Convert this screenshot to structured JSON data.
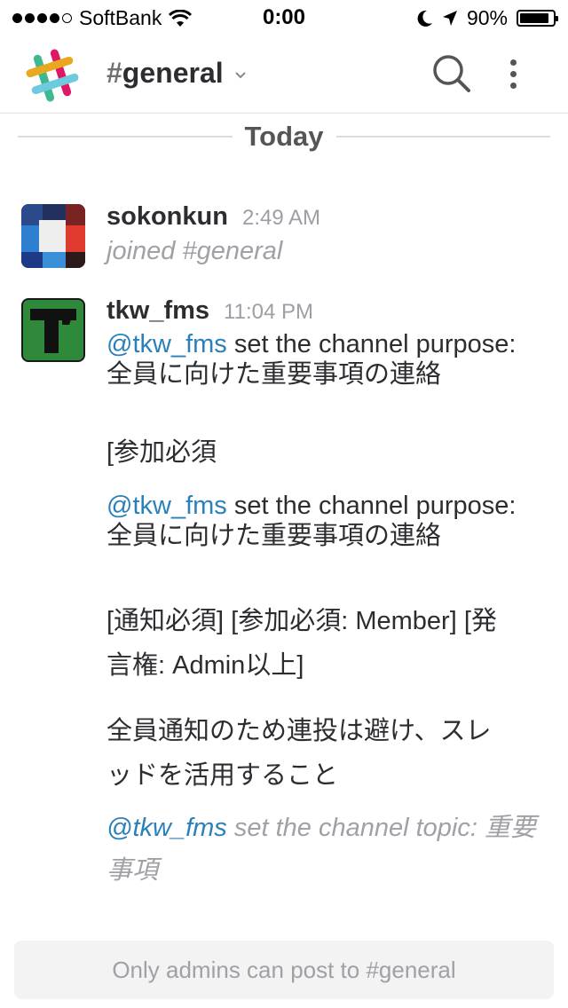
{
  "status_bar": {
    "carrier": "SoftBank",
    "time": "0:00",
    "battery": "90%"
  },
  "nav": {
    "hash": "#",
    "channel_name": "general"
  },
  "divider": {
    "label": "Today"
  },
  "messages": [
    {
      "author": "sokonkun",
      "time": "2:49 AM",
      "system_text": "joined #general"
    },
    {
      "author": "tkw_fms",
      "time": "11:04 PM",
      "p1_mention": "@tkw_fms",
      "p1_text": " set the channel purpose:",
      "p1_line2": "全員に向けた重要事項の連絡",
      "p2": "[参加必須",
      "p3_mention": "@tkw_fms",
      "p3_text": " set the channel purpose:",
      "p3_line2": "全員に向けた重要事項の連絡",
      "p4_line1": "[通知必須] [参加必須: Member] [発",
      "p4_line2": "言権: Admin以上]",
      "p5_line1": "全員通知のため連投は避け、スレ",
      "p5_line2": "ッドを活用すること",
      "p6_mention": "@tkw_fms",
      "p6_text": " set the channel topic: 重要",
      "p6_line2": "事項"
    }
  ],
  "composer": {
    "placeholder": "Only admins can post to #general"
  },
  "colors": {
    "mention": "#2a80b9",
    "system_text": "#a0a0a6",
    "avatar_tkw_bg": "#2e8a3a"
  },
  "icons": [
    "signal-dots-icon",
    "wifi-icon",
    "moon-icon",
    "location-arrow-icon",
    "battery-icon",
    "slack-logo-icon",
    "chevron-down-icon",
    "search-icon",
    "more-vertical-icon"
  ]
}
